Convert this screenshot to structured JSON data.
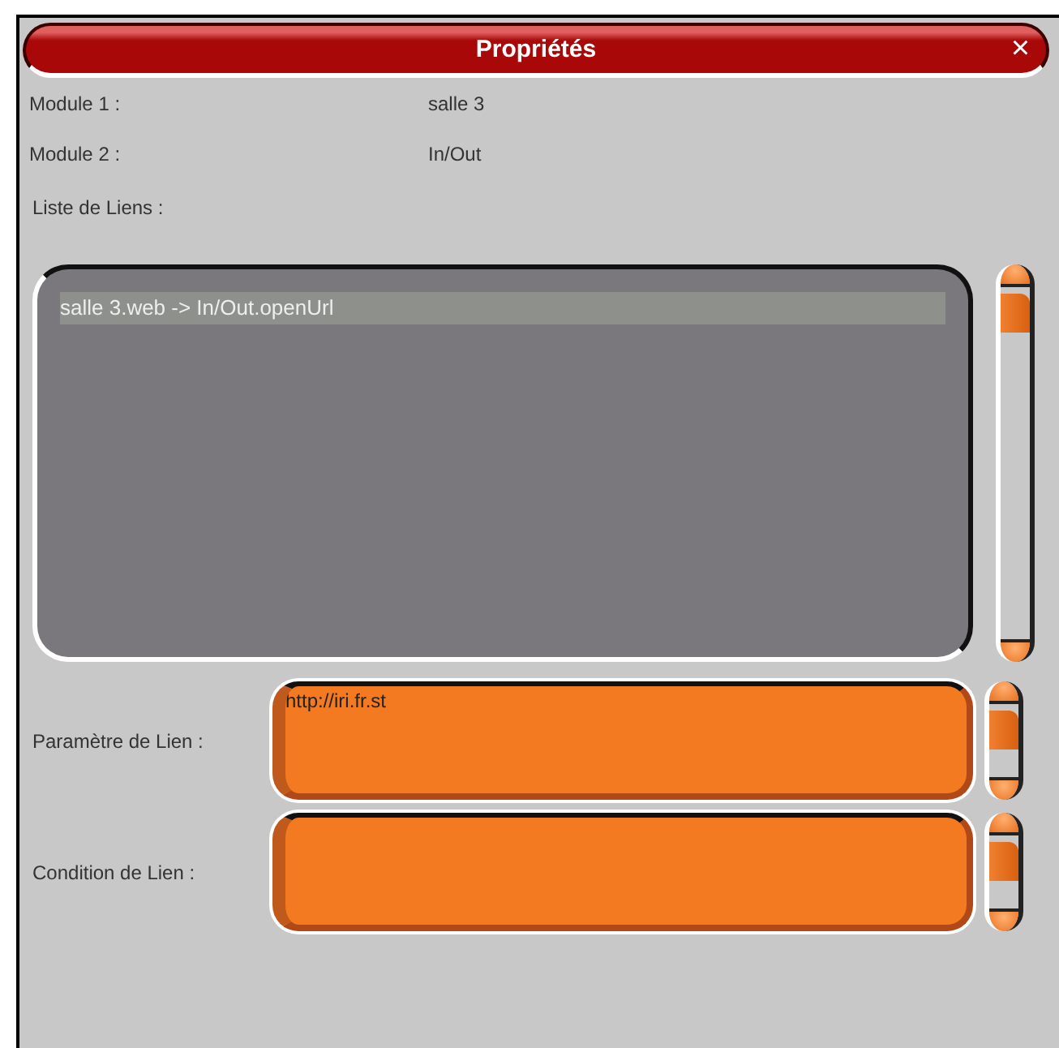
{
  "window": {
    "title": "Propriétés",
    "close": "×"
  },
  "properties": [
    {
      "label": "Module 1 :",
      "value": "salle 3"
    },
    {
      "label": "Module 2 :",
      "value": "In/Out"
    }
  ],
  "links_list": {
    "label": "Liste de Liens :",
    "items": [
      {
        "text": "salle 3.web -> In/Out.openUrl",
        "selected": true
      }
    ]
  },
  "fields": [
    {
      "label": "Paramètre de Lien :",
      "value": "http://iri.fr.st"
    },
    {
      "label": "Condition de Lien :"
    }
  ]
}
